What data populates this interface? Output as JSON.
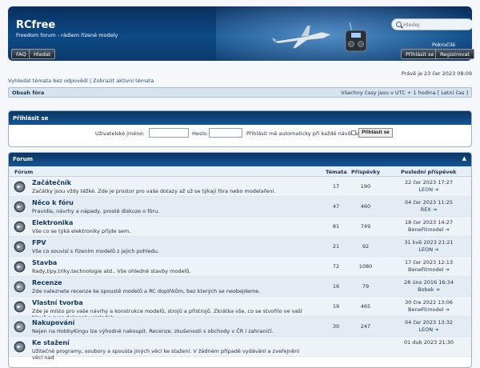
{
  "header": {
    "title": "RCfree",
    "description": "Freedom forum - rádiem řízené modely",
    "search_placeholder": "Hledej",
    "advanced_search": "Pokročilé hledání"
  },
  "nav": {
    "faq": "FAQ",
    "search": "Hledat",
    "login": "Přihlásit se",
    "register": "Registrovat"
  },
  "date_line": "Právě je 23 čer 2023 08:09",
  "quick_links": {
    "unanswered": "Vyhledat témata bez odpovědí",
    "separator": " | ",
    "active": "Zobrazit aktivní témata"
  },
  "breadcrumb_bar": {
    "left": "Obsah fóra",
    "right": "Všechny časy jsou v UTC + 1 hodina [ Letní čas ]"
  },
  "login_panel": {
    "title": "Přihlásit se",
    "username_label": "Uživatelské jméno:",
    "password_label": "Heslo:",
    "remember_label": "Přihlásit mě automaticky při každé návštěvě",
    "submit": "Přihlásit se"
  },
  "forum": {
    "title": "Forum",
    "collapse_glyph": "▲",
    "columns": {
      "forum": "Fórum",
      "topics": "Témata",
      "posts": "Příspěvky",
      "last_post": "Poslední příspěvek"
    },
    "rows": [
      {
        "name": "Začátečník",
        "desc": "Začátky jsou vždy těžké. Zde je prostor pro vaše dotazy až už se týkají fóra nebo modelaření.",
        "topics": "17",
        "posts": "190",
        "last_date": "22 čer 2023 17:27",
        "last_user": "LEON",
        "icon": "forum-read-icon"
      },
      {
        "name": "Něco k fóru",
        "desc": "Pravidla, návrhy a nápady, prostě diskuze o fóru.",
        "topics": "47",
        "posts": "460",
        "last_date": "04 čer 2023 11:25",
        "last_user": "REX",
        "icon": "forum-read-icon"
      },
      {
        "name": "Elektronika",
        "desc": "Vše co se týká elektroniky přijde sem.",
        "topics": "81",
        "posts": "749",
        "last_date": "18 čer 2023 14:27",
        "last_user": "BeneFitmodel",
        "icon": "forum-read-icon"
      },
      {
        "name": "FPV",
        "desc": "Vše co souvisí s řízením modelů z jejich pohledu.",
        "topics": "21",
        "posts": "92",
        "last_date": "31 kvě 2023 21:21",
        "last_user": "LEON",
        "icon": "forum-read-icon"
      },
      {
        "name": "Stavba",
        "desc": "Rady,tipy,triky,technologie atd.. Vše ohledně stavby modelů.",
        "topics": "72",
        "posts": "1080",
        "last_date": "17 čer 2023 12:13",
        "last_user": "BeneFitmodel",
        "icon": "forum-read-icon"
      },
      {
        "name": "Recenze",
        "desc": "Zde naleznete recenze ke spoustě modelů a RC doplňkům, bez kterých se neobejdeme.",
        "topics": "16",
        "posts": "79",
        "last_date": "28 úno 2016 16:34",
        "last_user": "Bobek",
        "icon": "forum-locked-icon"
      },
      {
        "name": "Vlastní tvorba",
        "desc": "Zde je místo pro vaše návrhy a konstrukce modelů, strojů a přístrojů. Zkrátka vše, co se stvořilo ve vaší hlavě a ruce dokonaly výsledek.",
        "topics": "19",
        "posts": "465",
        "last_date": "30 čre 2022 13:06",
        "last_user": "BeneFitmodel",
        "icon": "forum-read-icon"
      },
      {
        "name": "Nakupování",
        "desc": "Nejen na HobbyKingu lze výhodně nakoupit. Recenze, zkušenosti s obchody v ČR i zahraničí.",
        "topics": "30",
        "posts": "247",
        "last_date": "04 čer 2023 13:32",
        "last_user": "LEON",
        "icon": "forum-locked-icon"
      },
      {
        "name": "Ke stažení",
        "desc": "Užitečné programy, soubory a spousta jiných věcí ke stažení. V žádném případě vydávání a zveřejnění věcí nad",
        "topics": "",
        "posts": "",
        "last_date": "01 dub 2023 21:30",
        "last_user": "",
        "icon": "forum-read-icon"
      }
    ]
  }
}
